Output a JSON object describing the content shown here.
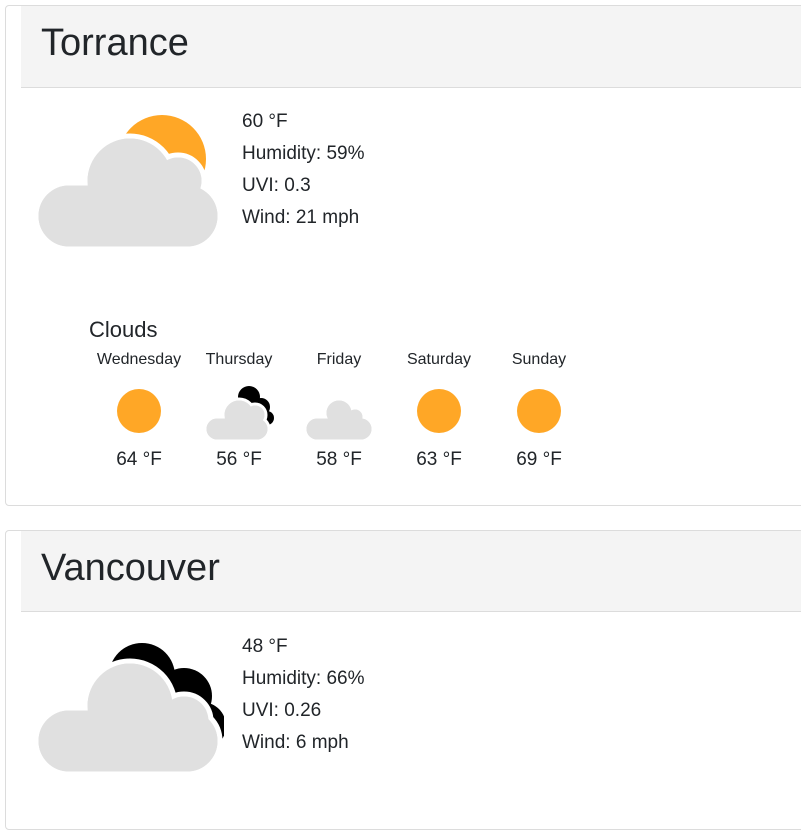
{
  "cities": [
    {
      "name": "Torrance",
      "current": {
        "temp": "60 °F",
        "humidity": "Humidity: 59%",
        "uvi": "UVI: 0.3",
        "wind": "Wind: 21 mph",
        "icon": "partly-cloudy-day-icon",
        "description": "Clouds"
      },
      "forecast": [
        {
          "day": "Wednesday",
          "temp": "64 °F",
          "icon": "sun-icon"
        },
        {
          "day": "Thursday",
          "temp": "56 °F",
          "icon": "cloudy-night-icon"
        },
        {
          "day": "Friday",
          "temp": "58 °F",
          "icon": "cloud-icon"
        },
        {
          "day": "Saturday",
          "temp": "63 °F",
          "icon": "sun-icon"
        },
        {
          "day": "Sunday",
          "temp": "69 °F",
          "icon": "sun-icon"
        }
      ]
    },
    {
      "name": "Vancouver",
      "current": {
        "temp": "48 °F",
        "humidity": "Humidity: 66%",
        "uvi": "UVI: 0.26",
        "wind": "Wind: 6 mph",
        "icon": "cloudy-night-icon"
      }
    }
  ],
  "colors": {
    "sun": "#FFA726",
    "cloud": "#E0E0E0",
    "moon": "#000000",
    "header_bg": "#F4F4F4"
  }
}
